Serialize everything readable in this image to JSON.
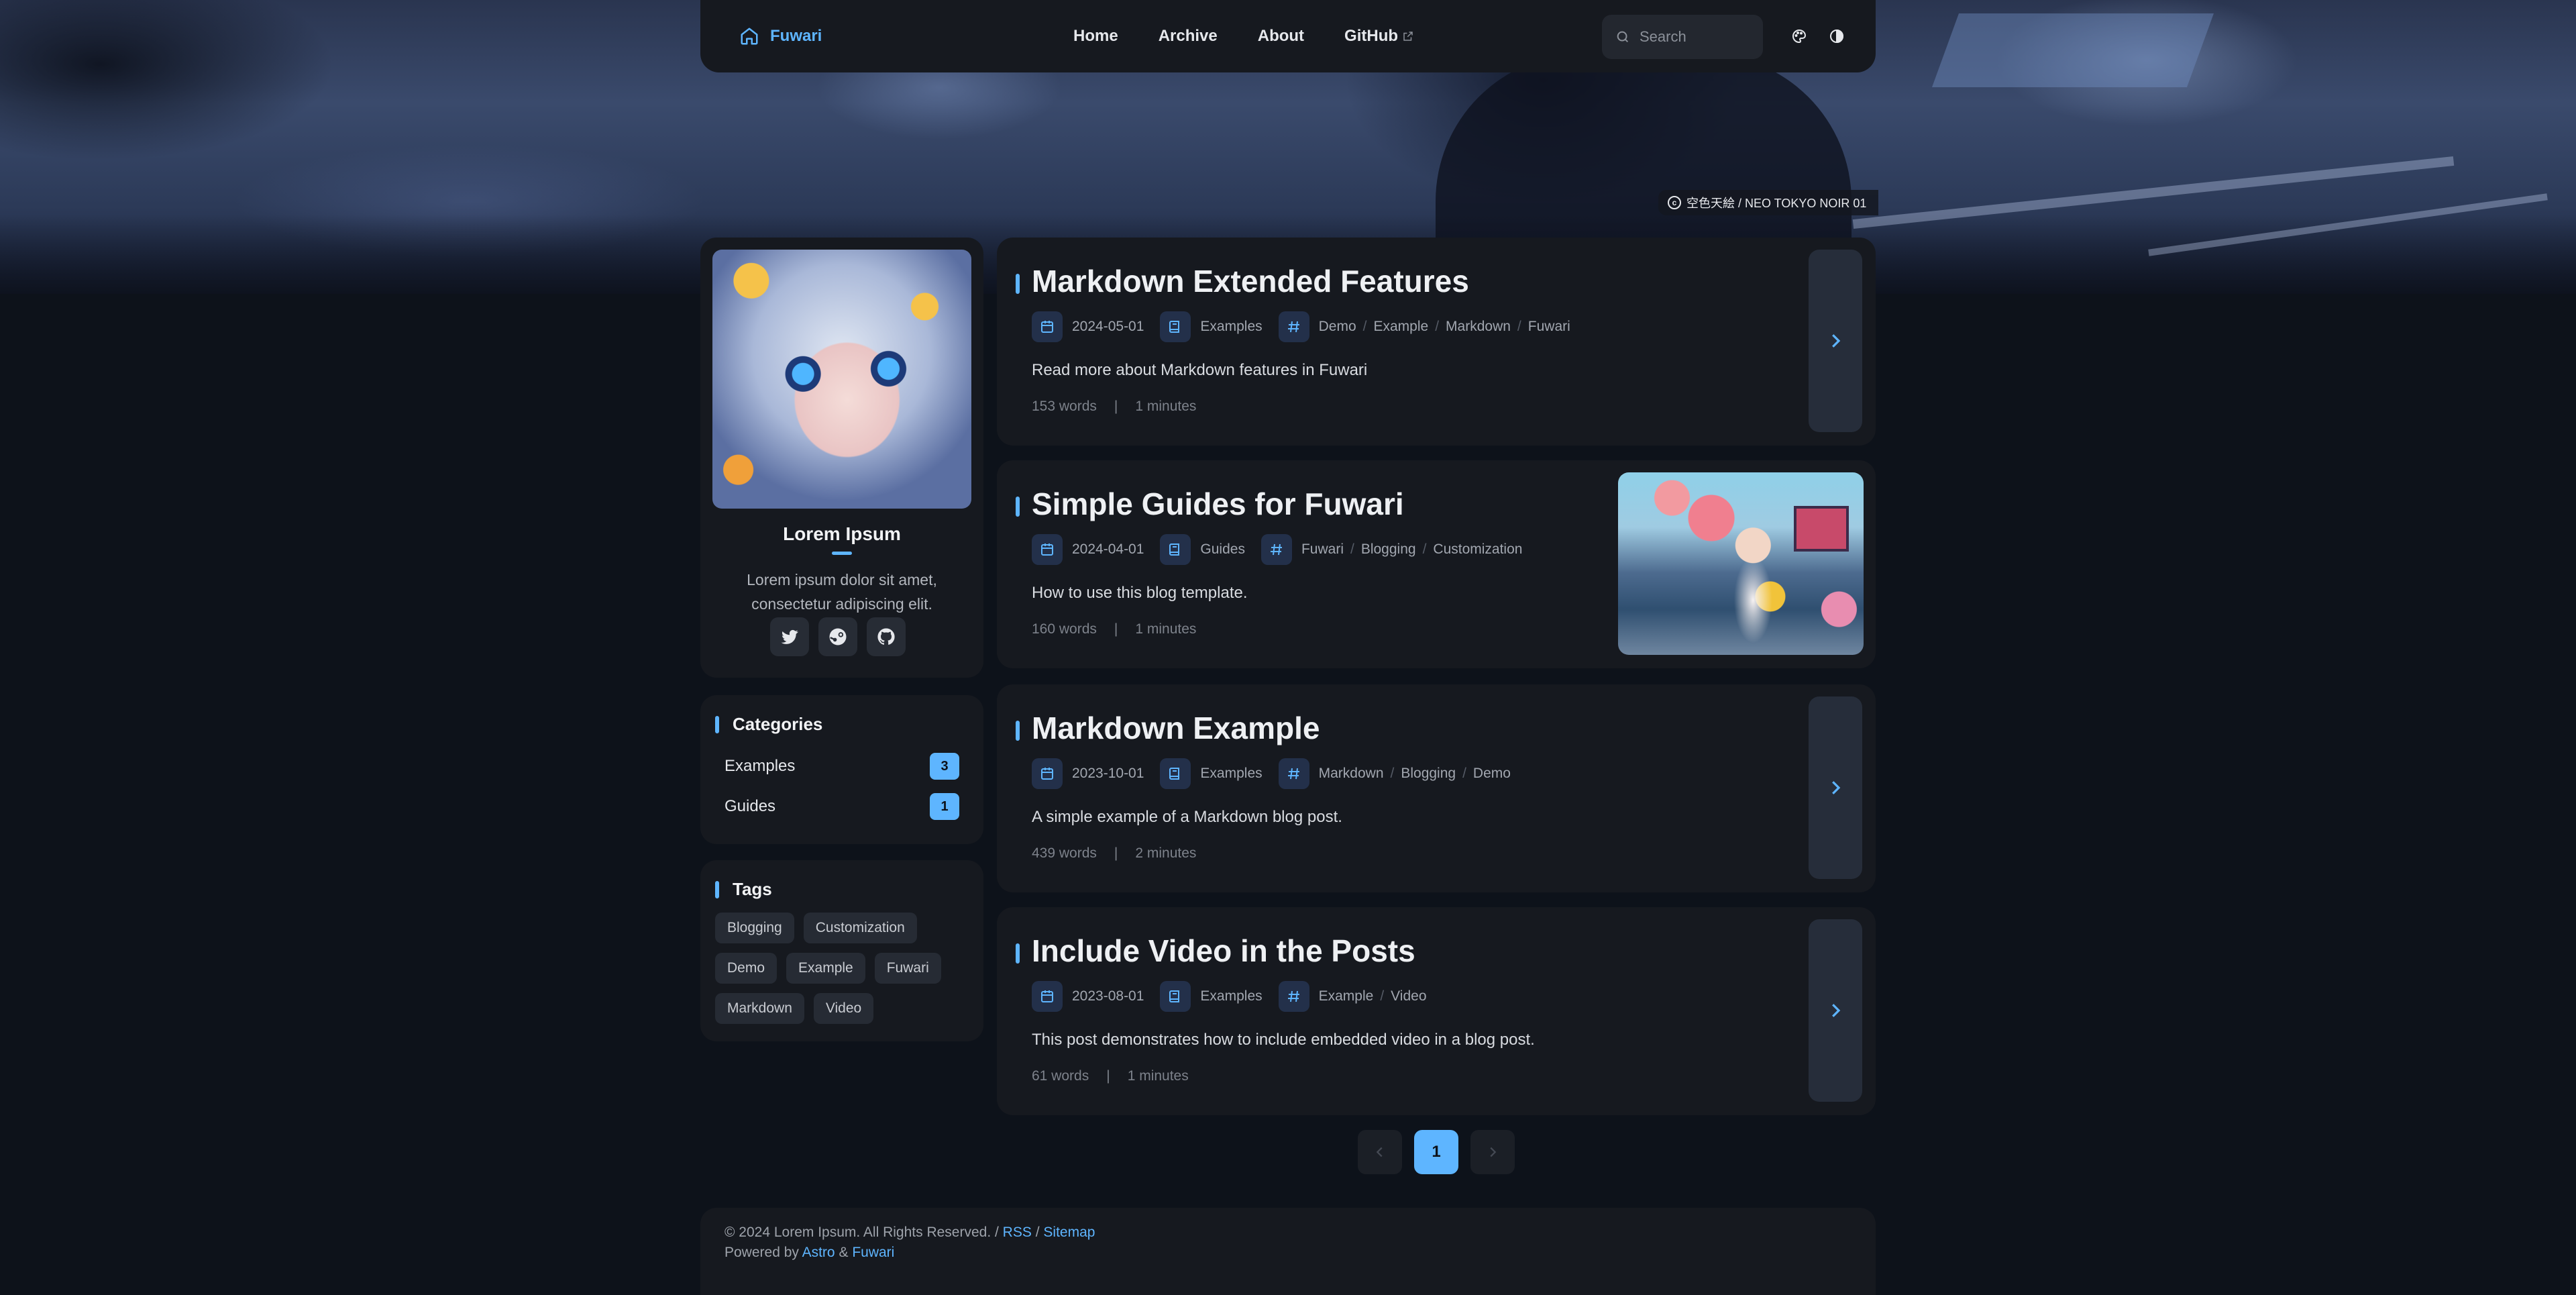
{
  "navbar": {
    "brand": "Fuwari",
    "links": [
      {
        "label": "Home"
      },
      {
        "label": "Archive"
      },
      {
        "label": "About"
      },
      {
        "label": "GitHub"
      }
    ],
    "search_placeholder": "Search",
    "icons": [
      "home-icon",
      "search-icon",
      "palette-icon",
      "theme-toggle-icon",
      "external-link-icon"
    ]
  },
  "banner": {
    "credit": "空色天絵 / NEO TOKYO NOIR 01"
  },
  "profile": {
    "name": "Lorem Ipsum",
    "bio": "Lorem ipsum dolor sit amet, consectetur adipiscing elit.",
    "socials": [
      "twitter-icon",
      "steam-icon",
      "github-icon"
    ]
  },
  "categories": {
    "title": "Categories",
    "items": [
      {
        "label": "Examples",
        "count": "3"
      },
      {
        "label": "Guides",
        "count": "1"
      }
    ]
  },
  "tags": {
    "title": "Tags",
    "items": [
      "Blogging",
      "Customization",
      "Demo",
      "Example",
      "Fuwari",
      "Markdown",
      "Video"
    ]
  },
  "posts": [
    {
      "title": "Markdown Extended Features",
      "date": "2024-05-01",
      "category": "Examples",
      "tags": [
        "Demo",
        "Example",
        "Markdown",
        "Fuwari"
      ],
      "description": "Read more about Markdown features in Fuwari",
      "words": "153 words",
      "time": "1 minutes"
    },
    {
      "title": "Simple Guides for Fuwari",
      "date": "2024-04-01",
      "category": "Guides",
      "tags": [
        "Fuwari",
        "Blogging",
        "Customization"
      ],
      "description": "How to use this blog template.",
      "words": "160 words",
      "time": "1 minutes"
    },
    {
      "title": "Markdown Example",
      "date": "2023-10-01",
      "category": "Examples",
      "tags": [
        "Markdown",
        "Blogging",
        "Demo"
      ],
      "description": "A simple example of a Markdown blog post.",
      "words": "439 words",
      "time": "2 minutes"
    },
    {
      "title": "Include Video in the Posts",
      "date": "2023-08-01",
      "category": "Examples",
      "tags": [
        "Example",
        "Video"
      ],
      "description": "This post demonstrates how to include embedded video in a blog post.",
      "words": "61 words",
      "time": "1 minutes"
    }
  ],
  "stats_separator": "|",
  "pagination": {
    "current": "1"
  },
  "footer": {
    "copyright": "© 2024 Lorem Ipsum. All Rights Reserved. /",
    "rss": "RSS",
    "slash": "/",
    "sitemap": "Sitemap",
    "powered_by": "Powered by",
    "astro": "Astro",
    "amp": "&",
    "fuwari": "Fuwari"
  },
  "colors": {
    "accent": "#5eb5ff",
    "background": "#0d121a",
    "card": "#16191f"
  }
}
